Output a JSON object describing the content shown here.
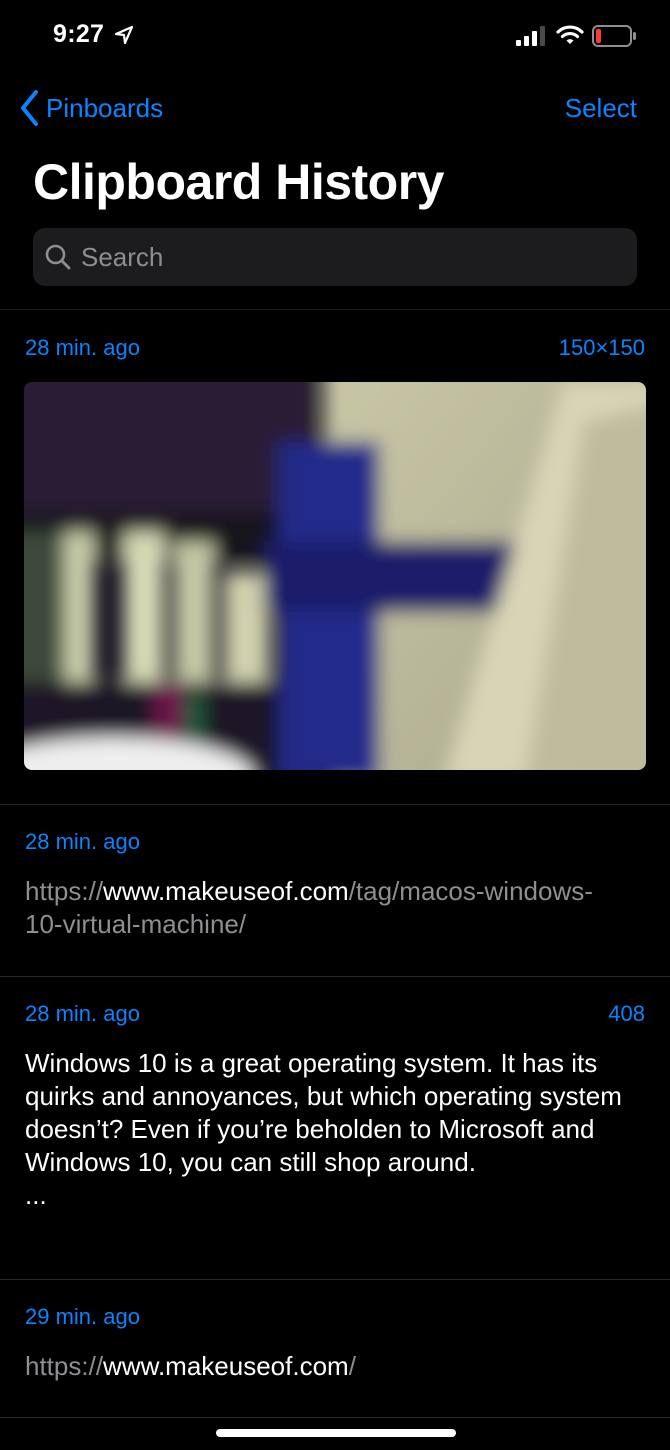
{
  "status_bar": {
    "time": "9:27",
    "icons": [
      "location-arrow-icon",
      "cellular-signal-icon",
      "wifi-icon",
      "battery-low-icon"
    ]
  },
  "nav": {
    "back_label": "Pinboards",
    "action_label": "Select"
  },
  "title": "Clipboard History",
  "search": {
    "placeholder": "Search",
    "value": ""
  },
  "clips": [
    {
      "time": "28 min. ago",
      "meta": "150×150",
      "type": "image"
    },
    {
      "time": "28 min. ago",
      "meta": "",
      "type": "url",
      "url_prefix": "https://",
      "url_host": "www.makeuseof.com",
      "url_path": "/tag/macos-windows-10-virtual-machine/"
    },
    {
      "time": "28 min. ago",
      "meta": "408",
      "type": "text",
      "text": "Windows 10 is a great operating system. It has its quirks and annoyances, but which operating system doesn’t? Even if you’re beholden to Microsoft and Windows 10, you can still shop around.",
      "ellipsis": "..."
    },
    {
      "time": "29 min. ago",
      "meta": "",
      "type": "url",
      "url_prefix": "https://",
      "url_host": "www.makeuseof.com",
      "url_path": "/"
    }
  ],
  "colors": {
    "background": "#000000",
    "accent": "#0a84ff",
    "secondary_text": "#8e8e93",
    "search_field": "#1c1c1e"
  }
}
